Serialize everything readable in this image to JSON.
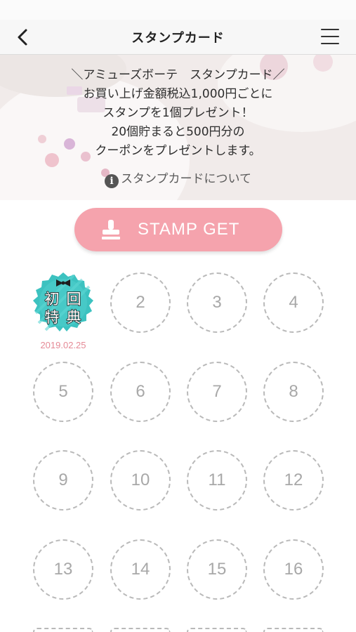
{
  "header": {
    "title": "スタンプカード"
  },
  "hero": {
    "lines": [
      "＼アミューズボーテ　スタンプカード／",
      "お買い上げ金額税込1,000円ごとに",
      "スタンプを1個プレゼント！",
      "20個貯まると500円分の",
      "クーポンをプレゼントします。"
    ],
    "info_link": "スタンプカードについて"
  },
  "stamp_button": {
    "label": "STAMP GET"
  },
  "first_stamp": {
    "badge_chars": [
      "初",
      "回",
      "特",
      "典"
    ],
    "date": "2019.02.25"
  },
  "slots": [
    "2",
    "3",
    "4",
    "5",
    "6",
    "7",
    "8",
    "9",
    "10",
    "11",
    "12",
    "13",
    "14",
    "15",
    "16"
  ],
  "colors": {
    "accent_pink": "#f5a3ad",
    "date_pink": "#e58a96",
    "badge_teal": "#3cc2c0",
    "slot_border": "#b9b9b9"
  }
}
